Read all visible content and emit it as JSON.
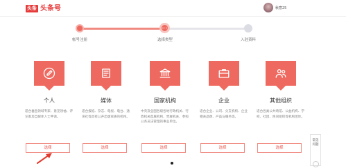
{
  "header": {
    "logo_badge": "头条",
    "logo_text": "头条号",
    "username": "秋意25"
  },
  "steps": [
    {
      "label": "帐号注册",
      "state": "done"
    },
    {
      "label": "选择类型",
      "state": "current"
    },
    {
      "label": "入驻资料",
      "state": "todo"
    }
  ],
  "cards": [
    {
      "title": "个人",
      "icon": "pen-icon",
      "desc": "适合垂直领域专家、意见领袖、评论家及自媒体人士申请。",
      "button": "选择"
    },
    {
      "title": "媒体",
      "icon": "newspaper-icon",
      "desc": "适合报纸、杂志、电视、电台、通讯社等具有公开出版资质的机构。",
      "button": "选择"
    },
    {
      "title": "国家机构",
      "icon": "government-building-icon",
      "desc": "中央及全国各级各地行政机关、行政机关直属机构、党群机关、参照公务员法管理的事业单位。",
      "button": "选择"
    },
    {
      "title": "企业",
      "icon": "briefcase-icon",
      "desc": "适合企业、公司、分支机构、企业相关品牌、产品与服务等。",
      "button": "选择"
    },
    {
      "title": "其他组织",
      "icon": "people-icon",
      "desc": "适合各类公共场馆、公益机构、学校、社团、民间组织等机构团体。",
      "button": "选择"
    }
  ],
  "float_panel": {
    "text": "常见问题"
  },
  "colors": {
    "accent": "#ee6a60",
    "brand": "#e63b3b"
  }
}
